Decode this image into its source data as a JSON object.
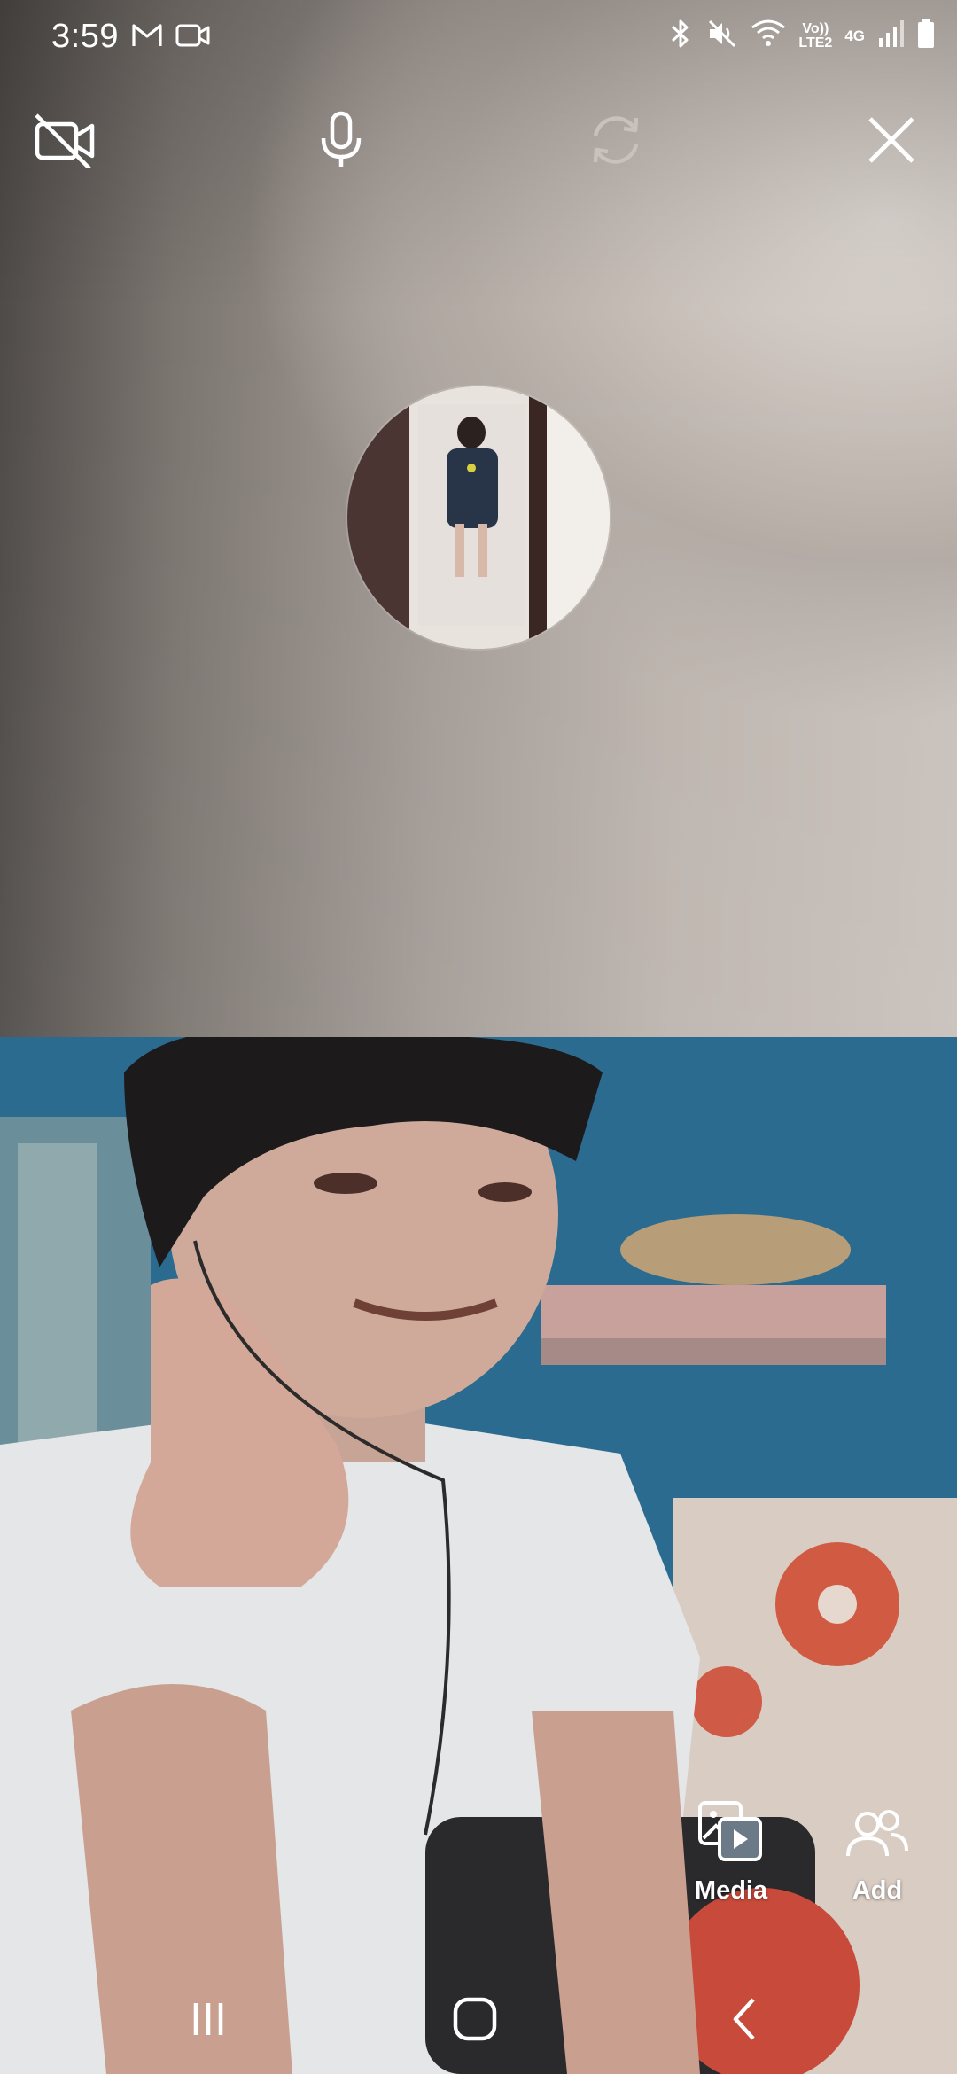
{
  "status_bar": {
    "time": "3:59",
    "network_label_top": "Vo))",
    "network_label_bottom": "LTE2",
    "network_type": "4G",
    "icons_left": [
      "gmail-icon",
      "video-icon"
    ],
    "icons_right": [
      "bluetooth-icon",
      "mute-icon",
      "wifi-icon",
      "signal-icon",
      "battery-icon"
    ]
  },
  "call_controls": {
    "camera_off_icon": "video-off-icon",
    "mic_icon": "microphone-icon",
    "flip_icon": "flip-camera-icon",
    "close_icon": "close-icon"
  },
  "actions": {
    "media_label": "Media",
    "add_label": "Add"
  },
  "colors": {
    "icon": "#ffffff",
    "icon_disabled": "#c7c2be"
  }
}
